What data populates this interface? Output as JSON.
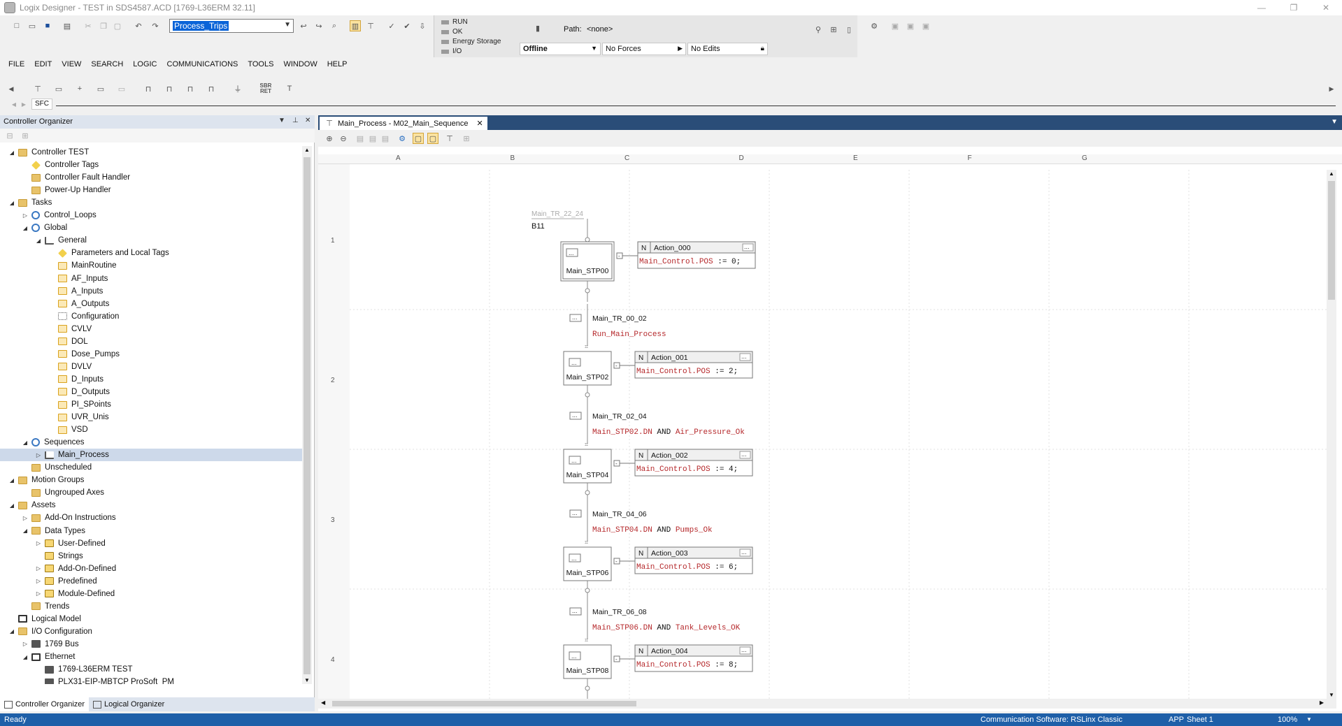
{
  "window": {
    "title": "Logix Designer - TEST in SDS4587.ACD [1769-L36ERM 32.11]",
    "controls": [
      "—",
      "❐",
      "✕"
    ]
  },
  "toolbar": {
    "task_combo_value": "Process_Trips"
  },
  "status": {
    "run": "RUN",
    "ok": "OK",
    "energy_storage": "Energy Storage",
    "io": "I/O",
    "path_label": "Path:",
    "path_value": "<none>",
    "mode": "Offline",
    "forces": "No Forces",
    "edits": "No Edits"
  },
  "menu": [
    "FILE",
    "EDIT",
    "VIEW",
    "SEARCH",
    "LOGIC",
    "COMMUNICATIONS",
    "TOOLS",
    "WINDOW",
    "HELP"
  ],
  "sfc_toolbar": {
    "tab_label": "SFC",
    "sbr_ret_label": "SBR RET"
  },
  "organizer": {
    "title": "Controller Organizer",
    "tree": [
      {
        "label": "Controller TEST",
        "level": 0,
        "toggle": "open",
        "icon": "folder"
      },
      {
        "label": "Controller Tags",
        "level": 1,
        "toggle": "",
        "icon": "tag"
      },
      {
        "label": "Controller Fault Handler",
        "level": 1,
        "toggle": "",
        "icon": "folder"
      },
      {
        "label": "Power-Up Handler",
        "level": 1,
        "toggle": "",
        "icon": "folder"
      },
      {
        "label": "Tasks",
        "level": 0,
        "toggle": "open",
        "icon": "folder"
      },
      {
        "label": "Control_Loops",
        "level": 1,
        "toggle": "closed",
        "icon": "task"
      },
      {
        "label": "Global",
        "level": 1,
        "toggle": "open",
        "icon": "task"
      },
      {
        "label": "General",
        "level": 2,
        "toggle": "open",
        "icon": "prog"
      },
      {
        "label": "Parameters and Local Tags",
        "level": 3,
        "toggle": "",
        "icon": "tag"
      },
      {
        "label": "MainRoutine",
        "level": 3,
        "toggle": "",
        "icon": "routine"
      },
      {
        "label": "AF_Inputs",
        "level": 3,
        "toggle": "",
        "icon": "routine"
      },
      {
        "label": "A_Inputs",
        "level": 3,
        "toggle": "",
        "icon": "routine"
      },
      {
        "label": "A_Outputs",
        "level": 3,
        "toggle": "",
        "icon": "routine"
      },
      {
        "label": "Configuration",
        "level": 3,
        "toggle": "",
        "icon": "cfg"
      },
      {
        "label": "CVLV",
        "level": 3,
        "toggle": "",
        "icon": "routine"
      },
      {
        "label": "DOL",
        "level": 3,
        "toggle": "",
        "icon": "routine"
      },
      {
        "label": "Dose_Pumps",
        "level": 3,
        "toggle": "",
        "icon": "routine"
      },
      {
        "label": "DVLV",
        "level": 3,
        "toggle": "",
        "icon": "routine"
      },
      {
        "label": "D_Inputs",
        "level": 3,
        "toggle": "",
        "icon": "routine"
      },
      {
        "label": "D_Outputs",
        "level": 3,
        "toggle": "",
        "icon": "routine"
      },
      {
        "label": "PI_SPoints",
        "level": 3,
        "toggle": "",
        "icon": "routine"
      },
      {
        "label": "UVR_Unis",
        "level": 3,
        "toggle": "",
        "icon": "routine"
      },
      {
        "label": "VSD",
        "level": 3,
        "toggle": "",
        "icon": "routine"
      },
      {
        "label": "Sequences",
        "level": 1,
        "toggle": "open",
        "icon": "task"
      },
      {
        "label": "Main_Process",
        "level": 2,
        "toggle": "closed",
        "icon": "prog",
        "selected": true
      },
      {
        "label": "Unscheduled",
        "level": 1,
        "toggle": "",
        "icon": "folder"
      },
      {
        "label": "Motion Groups",
        "level": 0,
        "toggle": "open",
        "icon": "folder"
      },
      {
        "label": "Ungrouped Axes",
        "level": 1,
        "toggle": "",
        "icon": "folder"
      },
      {
        "label": "Assets",
        "level": 0,
        "toggle": "open",
        "icon": "folder"
      },
      {
        "label": "Add-On Instructions",
        "level": 1,
        "toggle": "closed",
        "icon": "folder"
      },
      {
        "label": "Data Types",
        "level": 1,
        "toggle": "open",
        "icon": "folder"
      },
      {
        "label": "User-Defined",
        "level": 2,
        "toggle": "closed",
        "icon": "dtype"
      },
      {
        "label": "Strings",
        "level": 2,
        "toggle": "",
        "icon": "dtype"
      },
      {
        "label": "Add-On-Defined",
        "level": 2,
        "toggle": "closed",
        "icon": "dtype"
      },
      {
        "label": "Predefined",
        "level": 2,
        "toggle": "closed",
        "icon": "dtype"
      },
      {
        "label": "Module-Defined",
        "level": 2,
        "toggle": "closed",
        "icon": "dtype"
      },
      {
        "label": "Trends",
        "level": 1,
        "toggle": "",
        "icon": "folder"
      },
      {
        "label": "Logical Model",
        "level": 0,
        "toggle": "",
        "icon": "network"
      },
      {
        "label": "I/O Configuration",
        "level": 0,
        "toggle": "open",
        "icon": "folder"
      },
      {
        "label": "1769 Bus",
        "level": 1,
        "toggle": "closed",
        "icon": "module"
      },
      {
        "label": "Ethernet",
        "level": 1,
        "toggle": "open",
        "icon": "network"
      },
      {
        "label": "1769-L36ERM TEST",
        "level": 2,
        "toggle": "",
        "icon": "module"
      },
      {
        "label": "PLX31-EIP-MBTCP ProSoft_PM",
        "level": 2,
        "toggle": "",
        "icon": "module"
      }
    ],
    "tabs": [
      "Controller Organizer",
      "Logical Organizer"
    ]
  },
  "editor": {
    "tab_title": "Main_Process - M02_Main_Sequence",
    "columns": [
      "A",
      "B",
      "C",
      "D",
      "E",
      "F",
      "G"
    ],
    "rows": [
      "1",
      "2",
      "3",
      "4"
    ],
    "initial_jump": {
      "name": "Main_TR_22_24",
      "ref": "B11"
    },
    "steps": [
      {
        "name": "Main_STP00",
        "action": "Action_000",
        "qualifier": "N",
        "tag": "Main_Control.POS",
        "op": ":=",
        "value": "0;"
      },
      {
        "name": "Main_STP02",
        "action": "Action_001",
        "qualifier": "N",
        "tag": "Main_Control.POS",
        "op": ":=",
        "value": "2;"
      },
      {
        "name": "Main_STP04",
        "action": "Action_002",
        "qualifier": "N",
        "tag": "Main_Control.POS",
        "op": ":=",
        "value": "4;"
      },
      {
        "name": "Main_STP06",
        "action": "Action_003",
        "qualifier": "N",
        "tag": "Main_Control.POS",
        "op": ":=",
        "value": "6;"
      },
      {
        "name": "Main_STP08",
        "action": "Action_004",
        "qualifier": "N",
        "tag": "Main_Control.POS",
        "op": ":=",
        "value": "8;"
      }
    ],
    "transitions": [
      {
        "name": "Main_TR_00_02",
        "cond": [
          "Run_Main_Process"
        ]
      },
      {
        "name": "Main_TR_02_04",
        "cond": [
          "Main_STP02.DN",
          "AND",
          "Air_Pressure_Ok"
        ]
      },
      {
        "name": "Main_TR_04_06",
        "cond": [
          "Main_STP04.DN",
          "AND",
          "Pumps_Ok"
        ]
      },
      {
        "name": "Main_TR_06_08",
        "cond": [
          "Main_STP06.DN",
          "AND",
          "Tank_Levels_OK"
        ]
      }
    ],
    "ellipsis": "..."
  },
  "statusbar": {
    "left": "Ready",
    "comm": "Communication Software: RSLinx Classic",
    "app": "APP",
    "sheet": "Sheet 1",
    "zoom": "100%"
  },
  "colors": {
    "accent": "#1e5fa8",
    "tab_bar": "#2a4d78",
    "code_red": "#b5282b",
    "selection": "#cdd9ea"
  }
}
